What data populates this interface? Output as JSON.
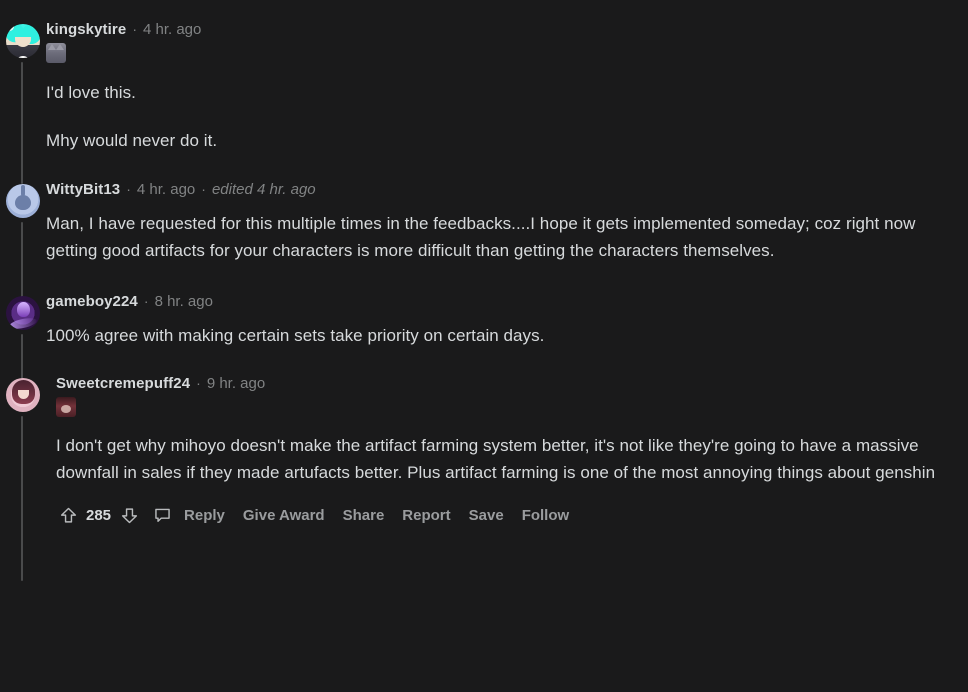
{
  "theme": {
    "background": "#1a1a1b",
    "text_primary": "#d7dadc",
    "text_muted": "#818384",
    "action_label": "#9a9c9e",
    "thread_line": "#4a4b4c"
  },
  "separator": "·",
  "comments": [
    {
      "id": "comment-kingskytire",
      "username": "kingskytire",
      "timestamp": "4 hr. ago",
      "edited": "",
      "avatar_icon": "anime-cyan-hair-avatar",
      "emoji_icon": "cat-emoji",
      "paragraphs": [
        "I'd love this.",
        "Mhy would never do it."
      ]
    },
    {
      "id": "comment-wittybit13",
      "username": "WittyBit13",
      "timestamp": "4 hr. ago",
      "edited": "edited 4 hr. ago",
      "avatar_icon": "reddit-snoo-avatar",
      "emoji_icon": "",
      "paragraphs": [
        "Man, I have requested for this multiple times in the feedbacks....I hope it gets implemented someday; coz right now getting good artifacts for your characters is more difficult than getting the characters themselves."
      ]
    },
    {
      "id": "comment-gameboy224",
      "username": "gameboy224",
      "timestamp": "8 hr. ago",
      "edited": "",
      "avatar_icon": "purple-orb-avatar",
      "emoji_icon": "",
      "paragraphs": [
        "100% agree with making certain sets take priority on certain days."
      ]
    },
    {
      "id": "comment-sweetcremepuff24",
      "username": "Sweetcremepuff24",
      "timestamp": "9 hr. ago",
      "edited": "",
      "avatar_icon": "anime-pink-hair-avatar",
      "emoji_icon": "dark-red-emoji",
      "paragraphs": [
        "I don't get why mihoyo doesn't make the artifact farming system better, it's not like they're going to have a massive downfall in sales if they made artufacts better. Plus artifact farming is one of the most annoying things about genshin"
      ]
    }
  ],
  "action_bar": {
    "upvote_icon": "upvote-arrow-icon",
    "downvote_icon": "downvote-arrow-icon",
    "comment_icon": "comment-bubble-icon",
    "score": "285",
    "links": [
      {
        "label": "Reply"
      },
      {
        "label": "Give Award"
      },
      {
        "label": "Share"
      },
      {
        "label": "Report"
      },
      {
        "label": "Save"
      },
      {
        "label": "Follow"
      }
    ]
  }
}
